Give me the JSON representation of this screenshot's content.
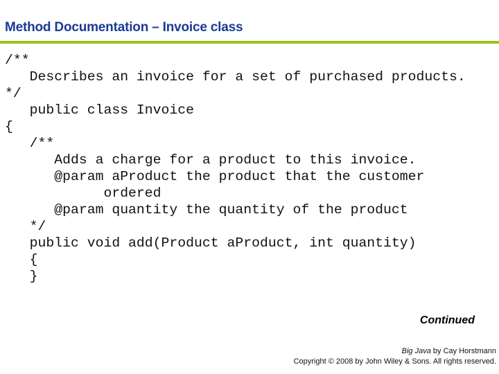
{
  "slide": {
    "title": "Method Documentation – Invoice class",
    "accent_color": "#9bc31c",
    "title_color": "#1a3a96"
  },
  "code": {
    "lines": [
      "/**",
      "   Describes an invoice for a set of purchased products.",
      "*/",
      "   public class Invoice",
      "{",
      "   /**",
      "      Adds a charge for a product to this invoice.",
      "      @param aProduct the product that the customer",
      "            ordered",
      "      @param quantity the quantity of the product",
      "   */",
      "   public void add(Product aProduct, int quantity)",
      "   {",
      "   }"
    ]
  },
  "continued_label": "Continued",
  "footer": {
    "book_title": "Big Java",
    "by_author": " by Cay Horstmann",
    "copyright": "Copyright © 2008 by John Wiley & Sons.  All rights reserved."
  }
}
